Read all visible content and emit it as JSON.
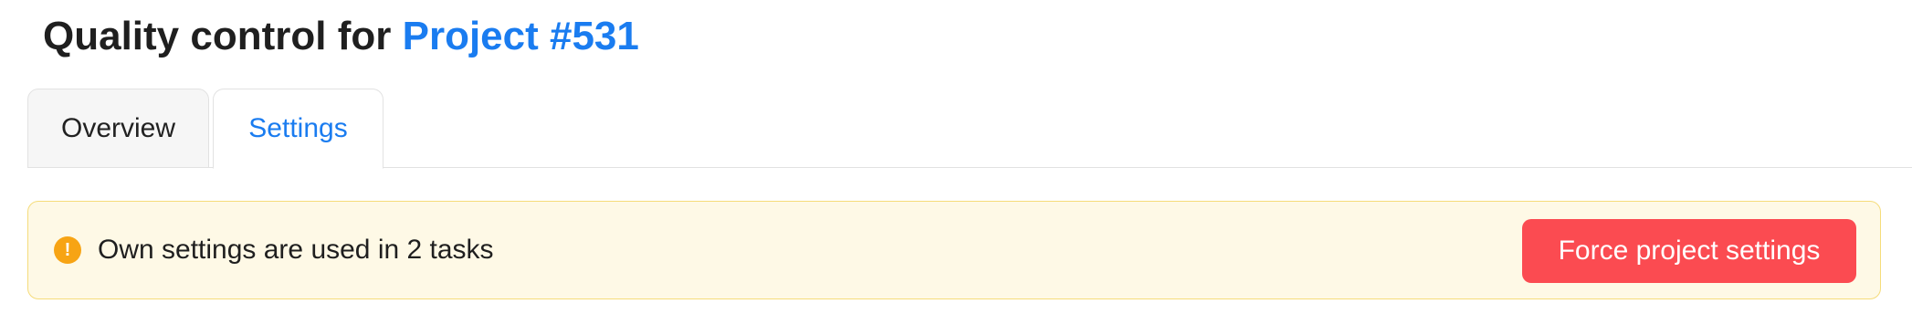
{
  "header": {
    "title_prefix": "Quality control for",
    "project_link": "Project #531"
  },
  "tabs": [
    {
      "label": "Overview",
      "active": false
    },
    {
      "label": "Settings",
      "active": true
    }
  ],
  "alert": {
    "icon": "exclamation-icon",
    "icon_glyph": "!",
    "message": "Own settings are used in 2 tasks",
    "button_label": "Force project settings"
  },
  "colors": {
    "link": "#1a7cf0",
    "alert_background": "#fef9e6",
    "alert_border": "#f5dc7a",
    "warning_icon": "#f7a414",
    "danger_button": "#fb4b51"
  }
}
